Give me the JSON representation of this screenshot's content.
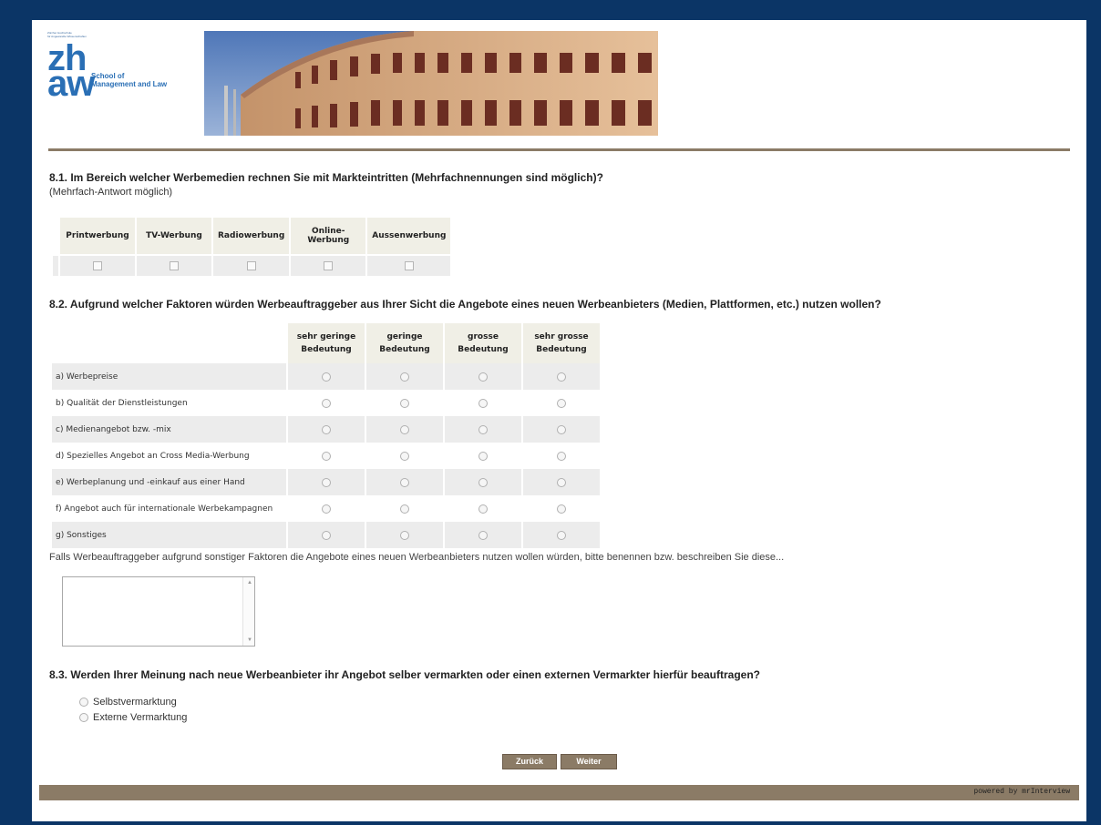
{
  "header": {
    "logo_tiny_line1": "Zürcher Hochschule",
    "logo_tiny_line2": "für Angewandte Wissenschaften",
    "logo_mark": "zh aw",
    "logo_school_line1": "School of",
    "logo_school_line2": "Management and Law"
  },
  "q1": {
    "title": "8.1. Im Bereich welcher Werbemedien rechnen Sie mit Markteintritten (Mehrfachnennungen sind möglich)?",
    "subtitle": "(Mehrfach-Antwort möglich)",
    "columns": [
      "Printwerbung",
      "TV-Werbung",
      "Radiowerbung",
      "Online-Werbung",
      "Aussenwerbung"
    ]
  },
  "q2": {
    "title": "8.2. Aufgrund welcher Faktoren würden Werbeauftraggeber aus Ihrer Sicht die Angebote eines neuen Werbeanbieters (Medien, Plattformen, etc.) nutzen wollen?",
    "columns": [
      "sehr geringe Bedeutung",
      "geringe Bedeutung",
      "grosse Bedeutung",
      "sehr grosse Bedeutung"
    ],
    "rows": [
      "a) Werbepreise",
      "b) Qualität der Dienstleistungen",
      "c) Medienangebot bzw. -mix",
      "d) Spezielles Angebot an Cross Media-Werbung",
      "e) Werbeplanung und -einkauf aus einer Hand",
      "f) Angebot auch für internationale Werbekampagnen",
      "g) Sonstiges"
    ],
    "other_prompt": "Falls Werbeauftraggeber aufgrund sonstiger Faktoren die Angebote eines neuen Werbeanbieters nutzen wollen würden, bitte benennen bzw. beschreiben Sie diese...",
    "other_value": ""
  },
  "q3": {
    "title": "8.3. Werden Ihrer Meinung nach neue Werbeanbieter ihr Angebot selber vermarkten oder einen externen Vermarkter hierfür beauftragen?",
    "options": [
      "Selbstvermarktung",
      "Externe Vermarktung"
    ]
  },
  "nav": {
    "back_label": "Zurück",
    "next_label": "Weiter"
  },
  "footer": {
    "powered_by": "powered by mrInterview"
  },
  "colors": {
    "frame": "#0b3566",
    "accent_brown": "#8b7b66",
    "header_cell": "#f0efe6",
    "logo_blue": "#2a6fb5"
  }
}
